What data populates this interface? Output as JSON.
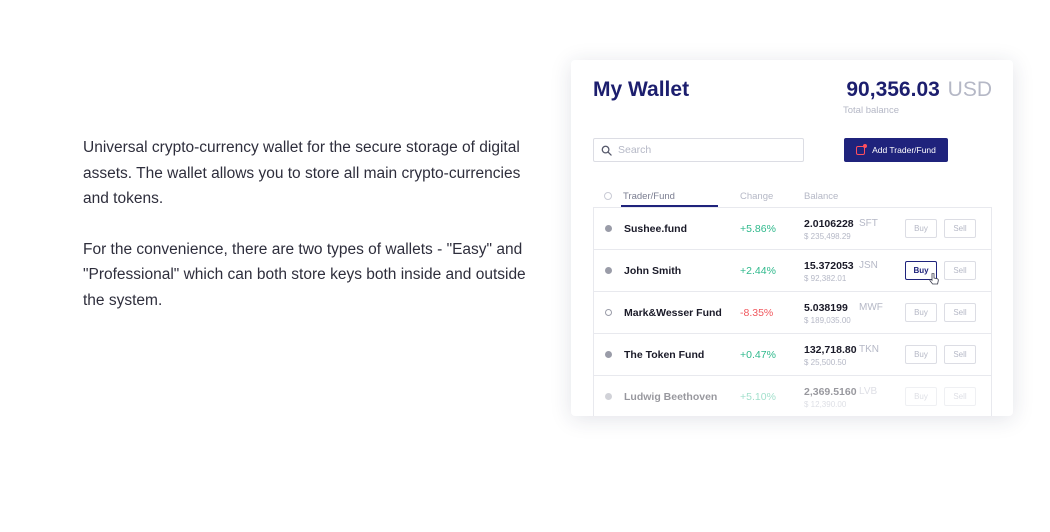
{
  "intro": {
    "paragraph1": "Universal crypto-currency wallet for the secure storage of digital assets. The wallet allows you to store all main crypto-currencies and tokens.",
    "paragraph2": "For the convenience, there are two types of wallets - \"Easy\" and \"Professional\" which can both store keys both inside and outside the system."
  },
  "wallet": {
    "title": "My Wallet",
    "balance_amount": "90,356.03",
    "balance_currency": "USD",
    "balance_label": "Total balance",
    "search_placeholder": "Search",
    "add_button_label": "Add Trader/Fund",
    "colors": {
      "primary": "#1f237c",
      "accent": "#ff4f5e",
      "positive": "#2fb98c",
      "negative": "#f0585e"
    }
  },
  "table": {
    "headers": {
      "name": "Trader/Fund",
      "change": "Change",
      "balance": "Balance"
    },
    "buy_label": "Buy",
    "sell_label": "Sell",
    "rows": [
      {
        "name": "Sushee.fund",
        "change": "+5.86%",
        "qty": "2.0106228",
        "symbol": "SFT",
        "usd": "$ 235,498.29"
      },
      {
        "name": "John Smith",
        "change": "+2.44%",
        "qty": "15.372053",
        "symbol": "JSN",
        "usd": "$ 92,382.01"
      },
      {
        "name": "Mark&Wesser Fund",
        "change": "-8.35%",
        "qty": "5.038199",
        "symbol": "MWF",
        "usd": "$ 189,035.00"
      },
      {
        "name": "The Token Fund",
        "change": "+0.47%",
        "qty": "132,718.80",
        "symbol": "TKN",
        "usd": "$ 25,500.50"
      },
      {
        "name": "Ludwig Beethoven",
        "change": "+5.10%",
        "qty": "2,369.5160",
        "symbol": "LVB",
        "usd": "$ 12,390.00"
      }
    ]
  }
}
